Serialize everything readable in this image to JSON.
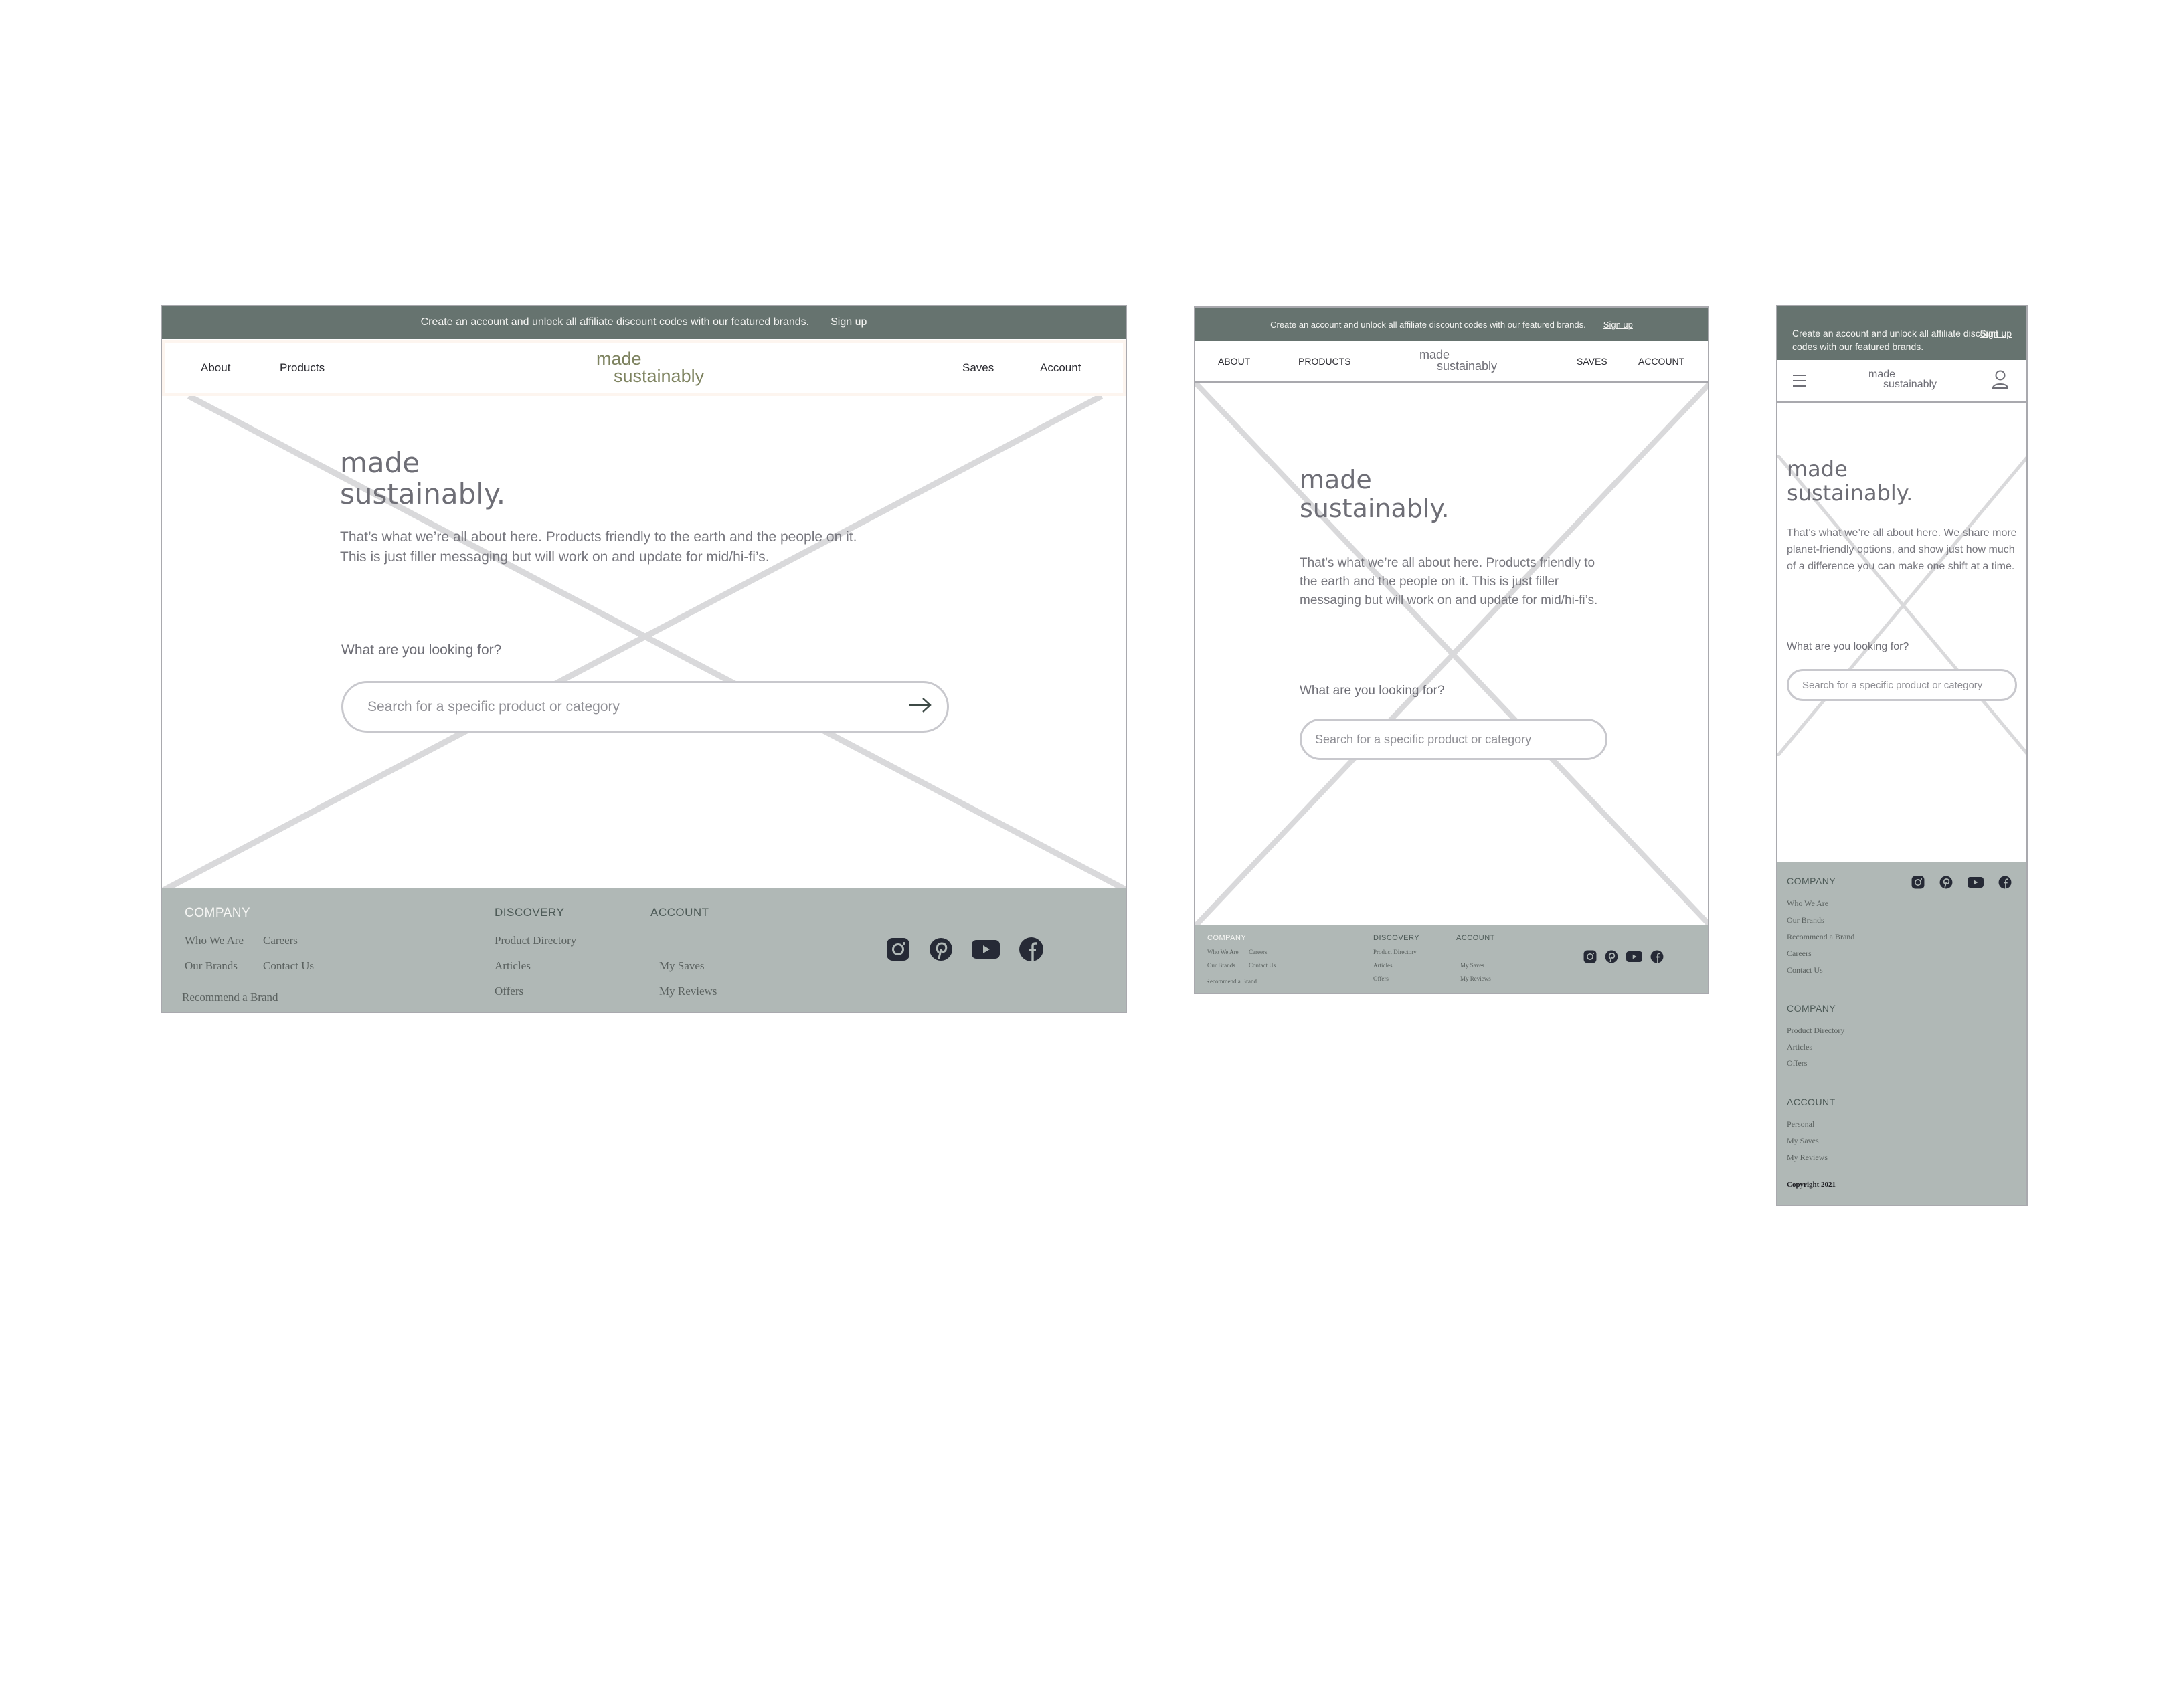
{
  "brand": {
    "line1": "made",
    "line2": "sustainably"
  },
  "colors": {
    "promo_bg": "#66736f",
    "footer_bg": "#b0b8b6",
    "logo_desktop": "#7e8360",
    "icon_dark": "#262a36",
    "placeholder_cross": "#d9d9db"
  },
  "desktop": {
    "promo": {
      "text": "Create an account and unlock all affiliate discount codes with our featured brands.",
      "signup": "Sign up"
    },
    "nav": {
      "left": [
        "About",
        "Products"
      ],
      "right": [
        "Saves",
        "Account"
      ]
    },
    "hero": {
      "title_line1": "made",
      "title_line2": "sustainably.",
      "body_line1": "That’s what we’re all about here. Products friendly to the earth and the people on it.",
      "body_line2": "This is just filler messaging but will work on and update for mid/hi-fi’s."
    },
    "search": {
      "label": "What are you looking for?",
      "placeholder": "Search for a specific product or category",
      "submit_icon": "arrow-right-icon"
    },
    "footer": {
      "company": {
        "heading": "COMPANY",
        "links": [
          "Who We Are",
          "Careers",
          "Our Brands",
          "Contact Us",
          "Recommend a Brand"
        ]
      },
      "discovery": {
        "heading": "DISCOVERY",
        "links": [
          "Product Directory",
          "Articles",
          "Offers"
        ]
      },
      "account": {
        "heading": "ACCOUNT",
        "links": [
          "My Saves",
          "My Reviews"
        ]
      },
      "social": [
        "instagram-icon",
        "pinterest-icon",
        "youtube-icon",
        "facebook-icon"
      ]
    }
  },
  "tablet": {
    "promo": {
      "text": "Create an account and unlock all affiliate discount codes with our featured brands.",
      "signup": "Sign up"
    },
    "nav": {
      "left": [
        "ABOUT",
        "PRODUCTS"
      ],
      "right": [
        "SAVES",
        "ACCOUNT"
      ]
    },
    "hero": {
      "title_line1": "made",
      "title_line2": "sustainably.",
      "body": "That’s what we’re all about here. Products friendly to the earth and the people on it. This is just filler messaging but will work on and update for mid/hi-fi’s."
    },
    "search": {
      "label": "What are you looking for?",
      "placeholder": "Search for a specific product or category"
    },
    "footer": {
      "company": {
        "heading": "COMPANY",
        "links": [
          "Who We Are",
          "Careers",
          "Our Brands",
          "Contact Us",
          "Recommend a Brand"
        ]
      },
      "discovery": {
        "heading": "DISCOVERY",
        "links": [
          "Product Directory",
          "Articles",
          "Offers"
        ]
      },
      "account": {
        "heading": "ACCOUNT",
        "links": [
          "My Saves",
          "My Reviews"
        ]
      }
    }
  },
  "mobile": {
    "promo": {
      "text": "Create an account and unlock all affiliate discount codes with our featured brands.",
      "signup": "Sign up"
    },
    "nav": {
      "menu_icon": "hamburger-menu-icon",
      "account_icon": "user-icon"
    },
    "hero": {
      "title_line1": "made",
      "title_line2": "sustainably.",
      "body": "That’s what we’re all about here. We share more planet-friendly options, and show just how much of a difference you can make one shift at a time."
    },
    "search": {
      "label": "What are you looking for?",
      "placeholder": "Search for a specific product or category"
    },
    "footer": {
      "company": {
        "heading": "COMPANY",
        "links": [
          "Who We Are",
          "Our Brands",
          "Recommend a Brand",
          "Careers",
          "Contact Us"
        ]
      },
      "discovery": {
        "heading": "COMPANY",
        "links": [
          "Product Directory",
          "Articles",
          "Offers"
        ]
      },
      "account": {
        "heading": "ACCOUNT",
        "links": [
          "Personal",
          "My Saves",
          "My Reviews"
        ]
      },
      "copyright": "Copyright 2021"
    }
  }
}
